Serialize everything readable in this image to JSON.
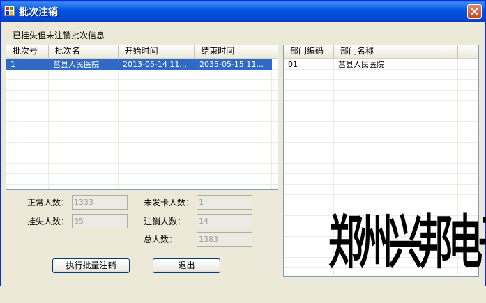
{
  "window": {
    "title": "批次注销"
  },
  "section_label": "已挂失但未注销批次信息",
  "batch_table": {
    "columns": [
      "批次号",
      "批次名",
      "开始时间",
      "结束时间"
    ],
    "rows": [
      {
        "batch_no": "1",
        "batch_name": "莒县人民医院",
        "start_time": "2013-05-14 11...",
        "end_time": "2035-05-15 11..."
      }
    ]
  },
  "dept_table": {
    "columns": [
      "部门编码",
      "部门名称"
    ],
    "rows": [
      {
        "code": "01",
        "name": "莒县人民医院"
      }
    ]
  },
  "stats": {
    "normal_label": "正常人数：",
    "normal_value": "1333",
    "lost_label": "挂失人数：",
    "lost_value": "35",
    "unissued_label": "未发卡人数：",
    "unissued_value": "1",
    "cancelled_label": "注销人数：",
    "cancelled_value": "14",
    "total_label": "总人数：",
    "total_value": "1383"
  },
  "buttons": {
    "execute": "执行批量注销",
    "exit": "退出"
  },
  "watermark": "郑州兴邦电子",
  "icons": {
    "app": "app-window-icon",
    "close": "close-icon"
  },
  "colors": {
    "title_bar": "#0454e0",
    "selection": "#316ac5",
    "window_bg": "#ece9d8",
    "close_button": "#c9421d"
  }
}
